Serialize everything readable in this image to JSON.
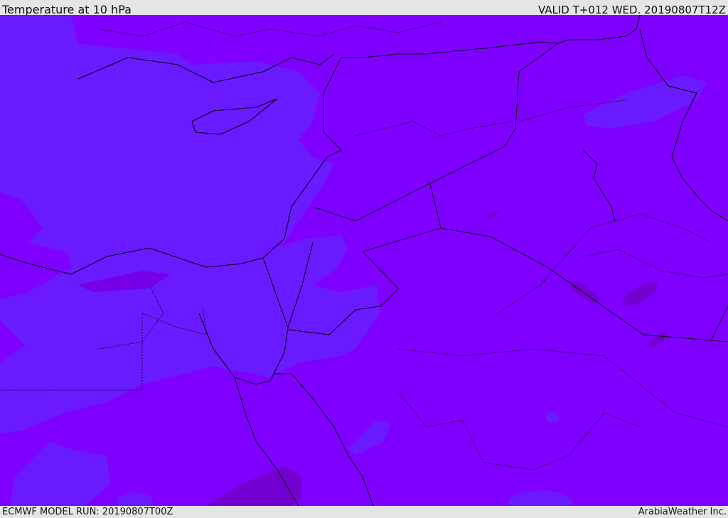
{
  "header": {
    "title": "Temperature at 10 hPa",
    "valid": "VALID T+012 WED. 20190807T12Z"
  },
  "footer": {
    "model_run": "ECMWF MODEL RUN: 20190807T00Z",
    "brand": "ArabiaWeather Inc."
  },
  "colors": {
    "base_fill": "#7f00ff",
    "cool_fill": "#6a1aff",
    "warm_fill": "#7200d0",
    "borders": "#000000"
  }
}
